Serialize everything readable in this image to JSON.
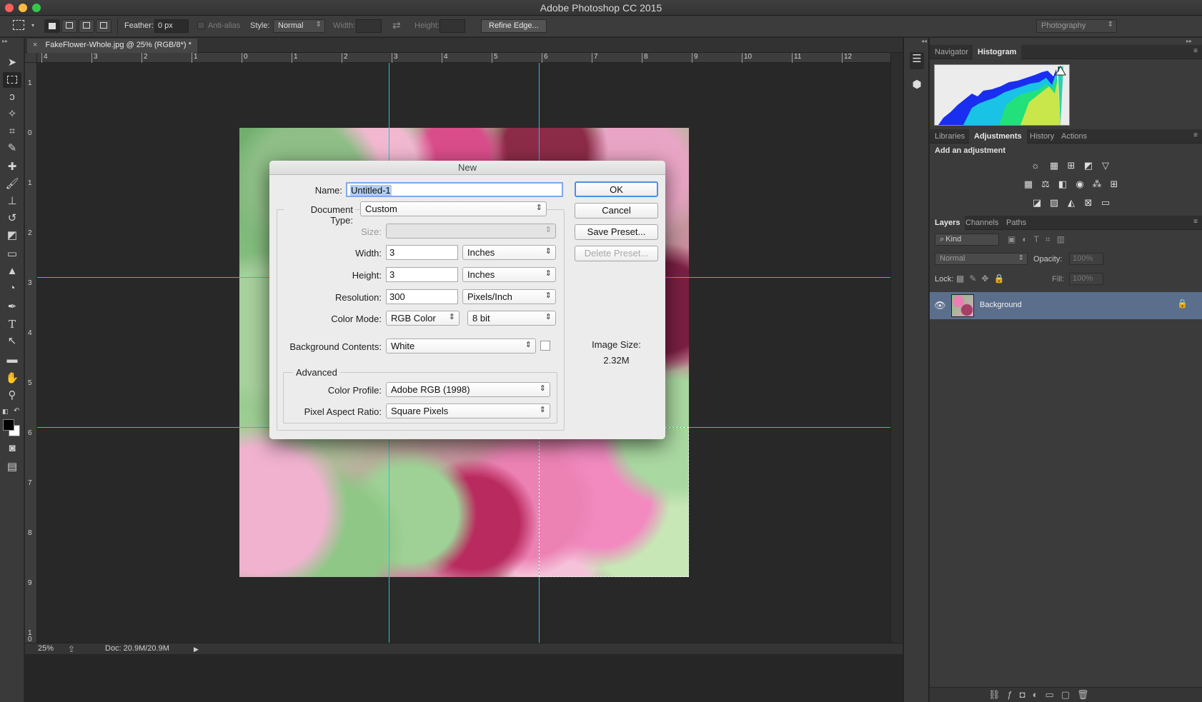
{
  "app": {
    "window_title": "Adobe Photoshop CC 2015",
    "workspace": "Photography"
  },
  "options_bar": {
    "feather_label": "Feather:",
    "feather_value": "0 px",
    "anti_alias_label": "Anti-alias",
    "style_label": "Style:",
    "style_value": "Normal",
    "width_label": "Width:",
    "height_label": "Height:",
    "refine_edge_label": "Refine Edge..."
  },
  "document": {
    "tab_title": "FakeFlower-Whole.jpg @ 25% (RGB/8*) *",
    "close_glyph": "×",
    "zoom": "25%",
    "doc_size": "Doc: 20.9M/20.9M"
  },
  "rulers": {
    "horizontal": [
      "4",
      "3",
      "2",
      "1",
      "0",
      "1",
      "2",
      "3",
      "4",
      "5",
      "6",
      "7",
      "8",
      "9",
      "10",
      "11",
      "12"
    ],
    "vertical": [
      "1",
      "0",
      "1",
      "2",
      "3",
      "4",
      "5",
      "6",
      "7",
      "8",
      "9",
      "1\n0"
    ]
  },
  "panels": {
    "top_tabs": [
      "Navigator",
      "Histogram"
    ],
    "top_active": 1,
    "mid_tabs": [
      "Libraries",
      "Adjustments",
      "History",
      "Actions"
    ],
    "mid_active": 1,
    "add_adjustment": "Add an adjustment",
    "layers_tabs": [
      "Layers",
      "Channels",
      "Paths"
    ],
    "layers_active": 0,
    "kind_filter": "Kind",
    "blend_mode": "Normal",
    "opacity_label": "Opacity:",
    "opacity_value": "100%",
    "lock_label": "Lock:",
    "fill_label": "Fill:",
    "fill_value": "100%",
    "layer_name": "Background"
  },
  "dialog": {
    "title": "New",
    "name_label": "Name:",
    "name_value": "Untitled-1",
    "document_type_label": "Document Type:",
    "document_type_value": "Custom",
    "size_label": "Size:",
    "width_label": "Width:",
    "width_value": "3",
    "width_unit": "Inches",
    "height_label": "Height:",
    "height_value": "3",
    "height_unit": "Inches",
    "resolution_label": "Resolution:",
    "resolution_value": "300",
    "resolution_unit": "Pixels/Inch",
    "color_mode_label": "Color Mode:",
    "color_mode_value": "RGB Color",
    "bit_depth_value": "8 bit",
    "background_label": "Background Contents:",
    "background_value": "White",
    "advanced_label": "Advanced",
    "color_profile_label": "Color Profile:",
    "color_profile_value": "Adobe RGB (1998)",
    "pixel_aspect_label": "Pixel Aspect Ratio:",
    "pixel_aspect_value": "Square Pixels",
    "ok_label": "OK",
    "cancel_label": "Cancel",
    "save_preset_label": "Save Preset...",
    "delete_preset_label": "Delete Preset...",
    "image_size_label": "Image Size:",
    "image_size_value": "2.32M"
  },
  "colors": {
    "guide": "#19c6d6",
    "selected_layer": "#5b6f8d",
    "default_button_ring": "#4b8ee8"
  }
}
